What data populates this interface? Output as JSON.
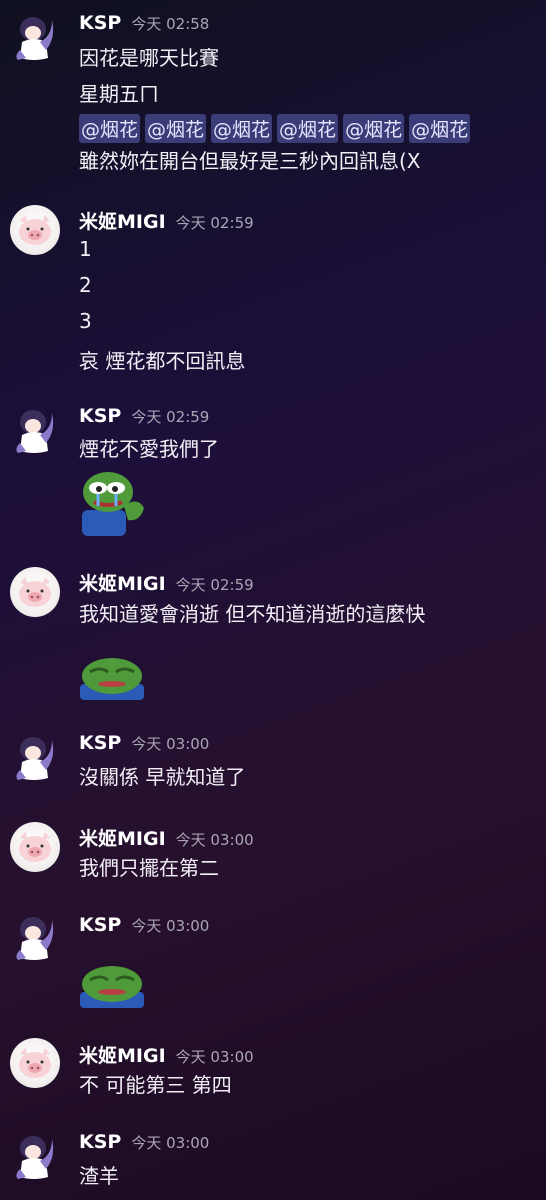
{
  "messages": [
    {
      "author": "KSP",
      "time": "今天 02:58",
      "lines": [
        "因花是哪天比賽",
        "星期五ㄇ"
      ],
      "mentions": [
        "@烟花",
        "@烟花",
        "@烟花",
        "@烟花",
        "@烟花",
        "@烟花"
      ],
      "after": "雖然妳在開台但最好是三秒內回訊息(X"
    },
    {
      "author": "米姬MIGI",
      "time": "今天 02:59",
      "lines": [
        "1",
        "2",
        "3",
        "哀 煙花都不回訊息"
      ]
    },
    {
      "author": "KSP",
      "time": "今天 02:59",
      "lines": [
        "煙花不愛我們了"
      ],
      "emoji": "crying-pepe-emoji"
    },
    {
      "author": "米姬MIGI",
      "time": "今天 02:59",
      "lines": [
        "我知道愛會消逝 但不知道消逝的這麼快"
      ],
      "emoji": "sad-pepe-emoji"
    },
    {
      "author": "KSP",
      "time": "今天 03:00",
      "lines": [
        "沒關係 早就知道了"
      ]
    },
    {
      "author": "米姬MIGI",
      "time": "今天 03:00",
      "lines": [
        "我們只擺在第二"
      ]
    },
    {
      "author": "KSP",
      "time": "今天 03:00",
      "lines": [],
      "emoji": "sad-pepe-emoji"
    },
    {
      "author": "米姬MIGI",
      "time": "今天 03:00",
      "lines": [
        "不  可能第三 第四"
      ]
    },
    {
      "author": "KSP",
      "time": "今天 03:00",
      "lines": [
        "渣羊"
      ]
    }
  ],
  "colors": {
    "mention_bg": "#3a3d78",
    "timestamp": "#a9a5b4",
    "name": "#ffffff"
  }
}
